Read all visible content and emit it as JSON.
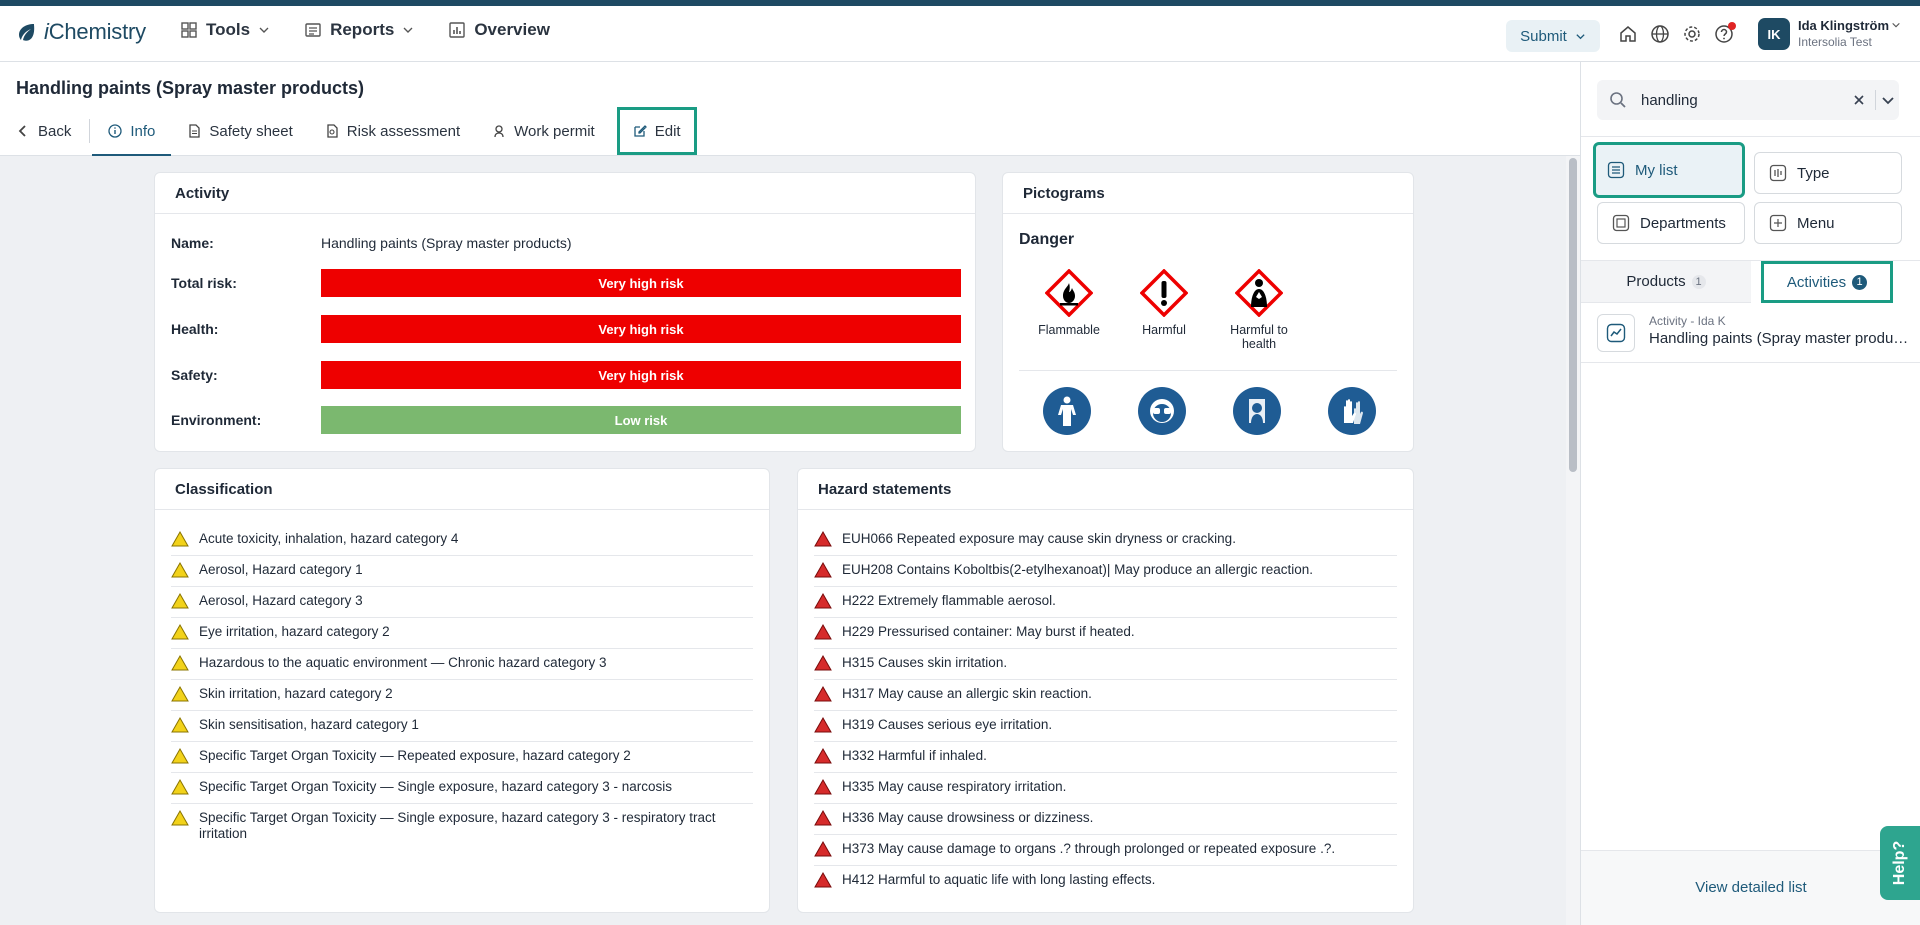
{
  "app": {
    "logo_text_i": "i",
    "logo_text_rest": "Chemistry"
  },
  "nav": [
    {
      "label": "Tools"
    },
    {
      "label": "Reports"
    },
    {
      "label": "Overview"
    }
  ],
  "header": {
    "submit_label": "Submit"
  },
  "user": {
    "initials": "IK",
    "name": "Ida Klingström",
    "org": "Intersolia Test"
  },
  "page": {
    "title": "Handling paints (Spray master products)",
    "tabs": {
      "back": "Back",
      "info": "Info",
      "safety_sheet": "Safety sheet",
      "risk_assessment": "Risk assessment",
      "work_permit": "Work permit",
      "edit": "Edit"
    }
  },
  "activity": {
    "title": "Activity",
    "rows": [
      {
        "label": "Name:",
        "value": "Handling paints (Spray master products)"
      },
      {
        "label": "Total risk:",
        "value": "Very high risk",
        "color": "#ee0000"
      },
      {
        "label": "Health:",
        "value": "Very high risk",
        "color": "#ee0000"
      },
      {
        "label": "Safety:",
        "value": "Very high risk",
        "color": "#ee0000"
      },
      {
        "label": "Environment:",
        "value": "Low risk",
        "color": "#7bb86f"
      }
    ]
  },
  "pictograms": {
    "title": "Pictograms",
    "signal_word": "Danger",
    "ghs": [
      {
        "icon": "flammable-icon",
        "label": "Flammable"
      },
      {
        "icon": "harmful-icon",
        "label": "Harmful"
      },
      {
        "icon": "health-hazard-icon",
        "label": "Harmful to health"
      }
    ],
    "ppe": [
      {
        "icon": "protective-suit-icon"
      },
      {
        "icon": "goggles-icon"
      },
      {
        "icon": "face-shield-icon"
      },
      {
        "icon": "gloves-icon"
      }
    ]
  },
  "classification": {
    "title": "Classification",
    "items": [
      "Acute toxicity, inhalation, hazard category 4",
      "Aerosol, Hazard category 1",
      "Aerosol, Hazard category 3",
      "Eye irritation, hazard category 2",
      "Hazardous to the aquatic environment — Chronic hazard category 3",
      "Skin irritation, hazard category 2",
      "Skin sensitisation, hazard category 1",
      "Specific Target Organ Toxicity — Repeated exposure, hazard category 2",
      "Specific Target Organ Toxicity — Single exposure, hazard category 3 - narcosis",
      "Specific Target Organ Toxicity — Single exposure, hazard category 3 - respiratory tract irritation"
    ]
  },
  "hazard_statements": {
    "title": "Hazard statements",
    "items": [
      "EUH066 Repeated exposure may cause skin dryness or cracking.",
      "EUH208 Contains Koboltbis(2-etylhexanoat)| May produce an allergic reaction.",
      "H222 Extremely flammable aerosol.",
      "H229 Pressurised container: May burst if heated.",
      "H315 Causes skin irritation.",
      "H317 May cause an allergic skin reaction.",
      "H319 Causes serious eye irritation.",
      "H332 Harmful if inhaled.",
      "H335 May cause respiratory irritation.",
      "H336 May cause drowsiness or dizziness.",
      "H373 May cause damage to organs .? through prolonged or repeated exposure .?.",
      "H412 Harmful to aquatic life with long lasting effects."
    ]
  },
  "sidebar": {
    "search": {
      "value": "handling"
    },
    "filters": {
      "my_list": "My list",
      "type": "Type",
      "departments": "Departments",
      "menu": "Menu"
    },
    "tabs": {
      "products": "Products",
      "products_count": "1",
      "activities": "Activities",
      "activities_count": "1"
    },
    "result": {
      "meta": "Activity - Ida K",
      "name": "Handling paints (Spray master products)"
    },
    "footer_link": "View detailed list"
  },
  "help": {
    "label": "Help?"
  },
  "colors": {
    "accent": "#1e5a7a",
    "highlight": "#1a9c84",
    "brand_dark": "#1e4a63",
    "danger_red": "#ee0000",
    "low_green": "#7bb86f"
  }
}
